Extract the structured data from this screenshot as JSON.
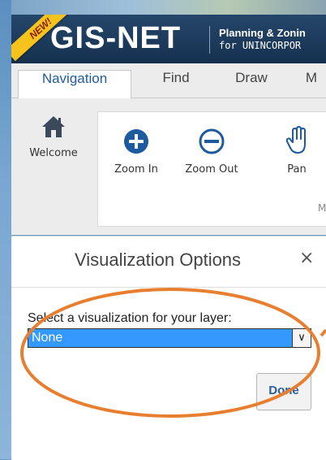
{
  "header": {
    "logo": "GIS-NET",
    "badge": "NEW!",
    "tagline_line1": "Planning & Zonin",
    "tagline_line2": "for UNINCORPOR"
  },
  "tabs": [
    {
      "label": "Navigation",
      "active": true
    },
    {
      "label": "Find",
      "active": false
    },
    {
      "label": "Draw",
      "active": false
    },
    {
      "label": "M",
      "active": false
    }
  ],
  "toolbar": {
    "welcome": "Welcome",
    "zoom_in": "Zoom In",
    "zoom_out": "Zoom Out",
    "pan": "Pan",
    "group_initial": "M"
  },
  "pane": {
    "title": "Visualization Options",
    "close": "×",
    "select_label": "Select a visualization for your layer:",
    "select_value": "None",
    "select_arrow": "∨",
    "done_label": "Done"
  },
  "colors": {
    "header_bg": "#1c3a5c",
    "accent_blue": "#1e5aa0",
    "selection_blue": "#3399ff",
    "annotation_orange": "#e87f30",
    "badge_yellow": "#f6c21c"
  }
}
